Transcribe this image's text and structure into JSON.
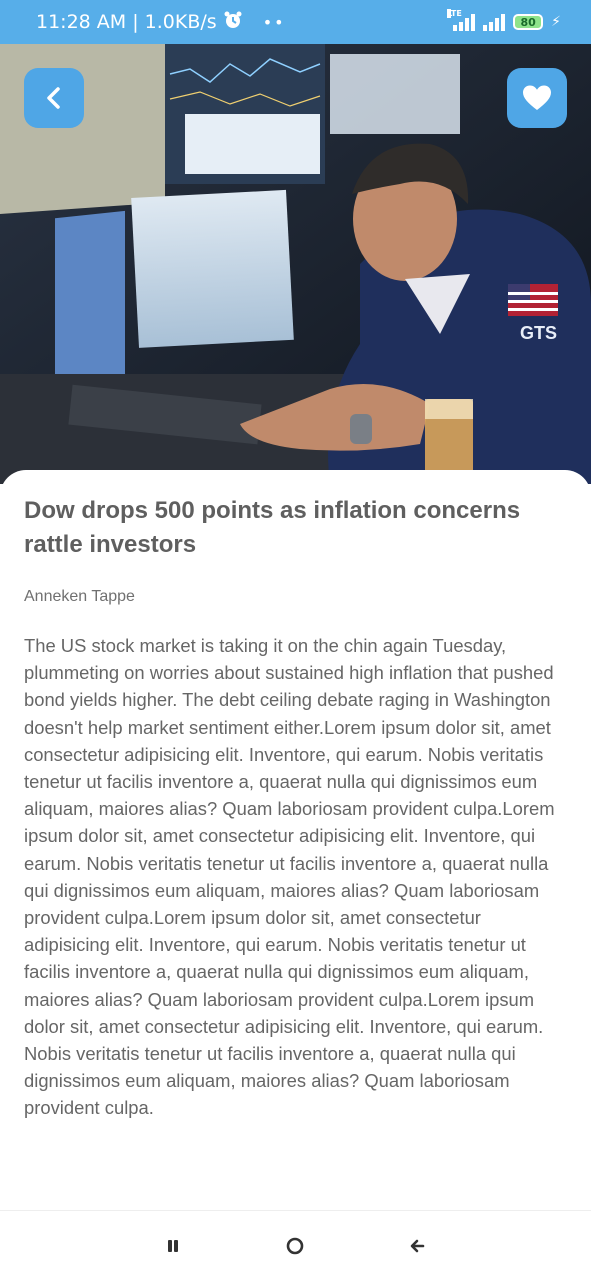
{
  "status_bar": {
    "time_speed": "11:28 AM | 1.0KB/s",
    "network_label": "LTE",
    "battery_level": "80"
  },
  "hero": {
    "description_icon": "trader-photo"
  },
  "top_actions": {
    "back_icon": "chevron-left-icon",
    "favorite_icon": "heart-icon"
  },
  "article": {
    "title": "Dow drops 500 points as inflation concerns rattle investors",
    "author": "Anneken Tappe",
    "body": "The US stock market is taking it on the chin again Tuesday, plummeting on worries about sustained high inflation that pushed bond yields higher. The debt ceiling debate raging in Washington doesn't help market sentiment either.Lorem ipsum dolor sit, amet consectetur adipisicing elit. Inventore, qui earum. Nobis veritatis tenetur ut facilis inventore a, quaerat nulla qui dignissimos eum aliquam, maiores alias? Quam laboriosam provident culpa.Lorem ipsum dolor sit, amet consectetur adipisicing elit. Inventore, qui earum. Nobis veritatis tenetur ut facilis inventore a, quaerat nulla qui dignissimos eum aliquam, maiores alias? Quam laboriosam provident culpa.Lorem ipsum dolor sit, amet consectetur adipisicing elit. Inventore, qui earum. Nobis veritatis tenetur ut facilis inventore a, quaerat nulla qui dignissimos eum aliquam, maiores alias? Quam laboriosam provident culpa.Lorem ipsum dolor sit, amet consectetur adipisicing elit. Inventore, qui earum. Nobis veritatis tenetur ut facilis inventore a, quaerat nulla qui dignissimos eum aliquam, maiores alias? Quam laboriosam provident culpa."
  },
  "colors": {
    "accent": "#57aee9",
    "button": "#4fa6e6",
    "title_text": "#5f5f5f",
    "body_text": "#666666"
  },
  "nav": {
    "recent_icon": "recent-apps-icon",
    "home_icon": "home-circle-icon",
    "back_icon": "back-arrow-icon"
  }
}
